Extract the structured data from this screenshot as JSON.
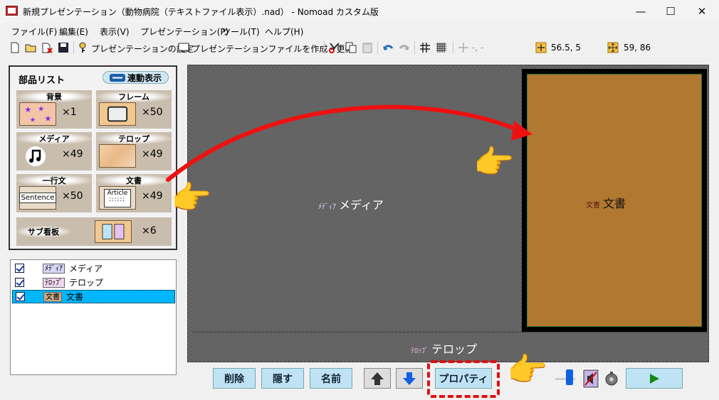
{
  "window": {
    "title": "新規プレゼンテーション（動物病院（テキストファイル表示）.nad） - Nomoad カスタム版",
    "minimize": "—",
    "maximize": "☐",
    "close": "✕"
  },
  "menu": [
    "ファイル(F)",
    "編集(E)",
    "表示(V)",
    "プレゼンテーション(P)",
    "ツール(T)",
    "ヘルプ(H)"
  ],
  "toolbar": {
    "settings_label": "プレゼンテーションの設定",
    "create_label": "プレゼンテーションファイルを作成・更新",
    "coord_placeholder": "-, -",
    "position_value": "56.5, 5",
    "size_value": "59, 86"
  },
  "parts_panel": {
    "title": "部品リスト",
    "link_button": "連動表示",
    "tiles": [
      {
        "label": "背景",
        "count": "×1",
        "icon": "stars-background"
      },
      {
        "label": "フレーム",
        "count": "×50",
        "icon": "frame"
      },
      {
        "label": "メディア",
        "count": "×49",
        "icon": "music-note"
      },
      {
        "label": "テロップ",
        "count": "×49",
        "icon": "telop-texture"
      },
      {
        "label": "一行文",
        "count": "×50",
        "thumb_text": "Sentence"
      },
      {
        "label": "文書",
        "count": "×49",
        "thumb_text": "Article"
      },
      {
        "label": "サブ看板",
        "count": "×6",
        "icon": "sub-signboard"
      }
    ]
  },
  "stage": {
    "media_tag": "ﾒﾃﾞｨｱ",
    "media_label": "メディア",
    "doc_tag": "文書",
    "doc_label": "文書",
    "telop_tag": "ﾃﾛｯﾌﾟ",
    "telop_label": "テロップ"
  },
  "layers": [
    {
      "tag": "ﾒﾃﾞｨｱ",
      "label": "メディア",
      "selected": false
    },
    {
      "tag": "ﾃﾛｯﾌﾟ",
      "label": "テロップ",
      "selected": false
    },
    {
      "tag": "文書",
      "label": "文書",
      "selected": true
    }
  ],
  "buttons": {
    "delete": "削除",
    "hide": "隠す",
    "rename": "名前",
    "properties": "プロパティ"
  },
  "colors": {
    "highlight": "#e01010",
    "selection": "#00b7ff",
    "document_fill": "#b07830"
  }
}
